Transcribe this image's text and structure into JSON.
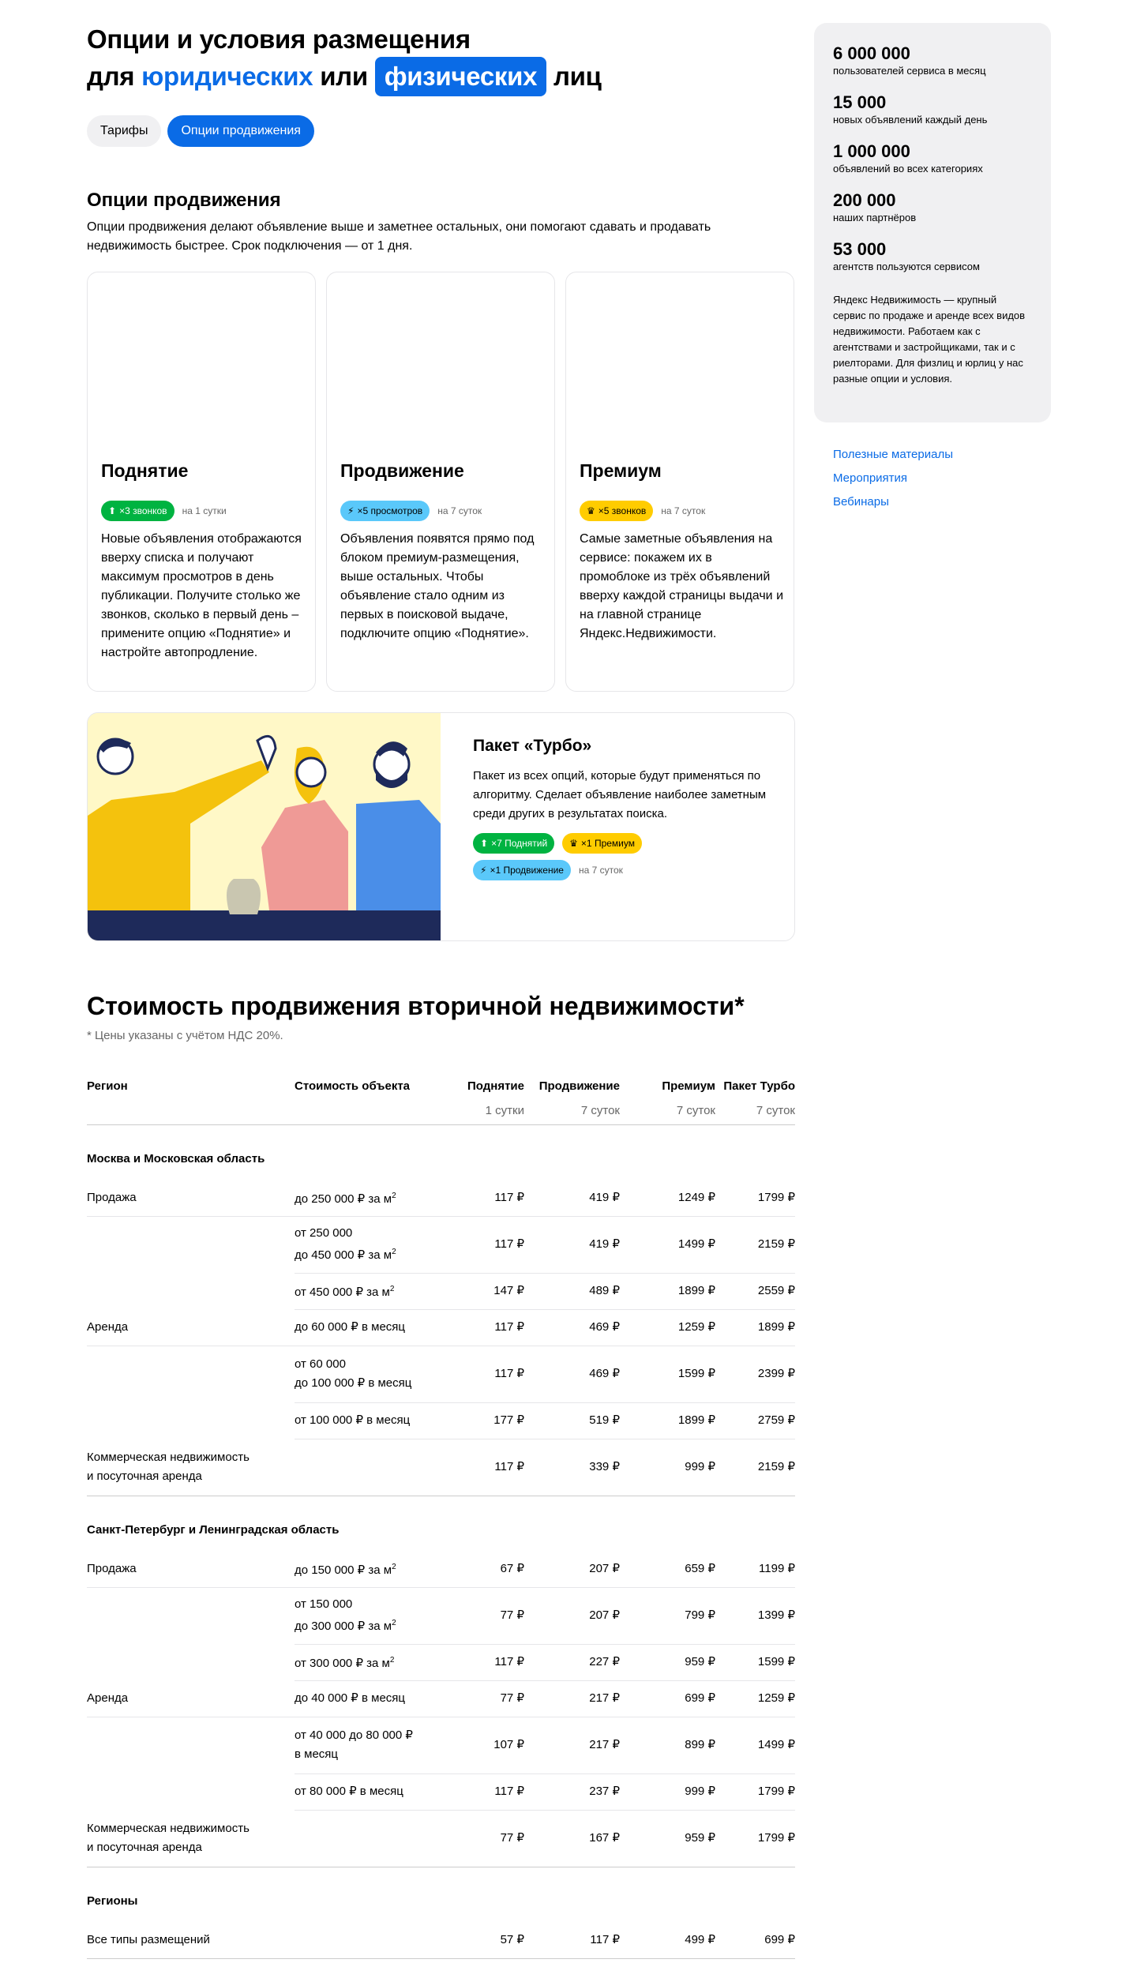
{
  "header": {
    "title_line1": "Опции и условия размещения",
    "title_for": "для",
    "title_legal": "юридических",
    "title_or": "или",
    "title_physical": "физических",
    "title_persons": "лиц"
  },
  "tabs": [
    {
      "label": "Тарифы",
      "active": false
    },
    {
      "label": "Опции продвижения",
      "active": true
    }
  ],
  "promo": {
    "heading": "Опции продвижения",
    "intro": "Опции продвижения делают объявление выше и заметнее остальных, они помогают сдавать и продавать недвижимость быстрее. Срок подключения — от 1 дня.",
    "cards": [
      {
        "title": "Поднятие",
        "badge": "×3 звонков",
        "period": "на 1 сутки",
        "desc": "Новые объявления отображаются вверху списка и получают максимум просмотров в день публикации. Получите столько же звонков, сколько в первый день – примените опцию «Поднятие» и настройте автопродление."
      },
      {
        "title": "Продвижение",
        "badge": "×5 просмотров",
        "period": "на 7 суток",
        "desc": "Объявления появятся прямо под блоком премиум-размещения, выше остальных. Чтобы объявление стало одним из первых в поисковой выдаче, подключите опцию «Поднятие»."
      },
      {
        "title": "Премиум",
        "badge": "×5 звонков",
        "period": "на 7 суток",
        "desc": "Самые заметные объявления на сервисе: покажем их в промоблоке из трёх объявлений вверху каждой страницы выдачи и на главной странице Яндекс.Недвижимости."
      }
    ],
    "turbo": {
      "title": "Пакет «Турбо»",
      "desc": "Пакет из всех опций, которые будут применяться по алгоритму. Сделает объявление наиболее заметным среди других в результатах поиска.",
      "badge_up": "×7 Поднятий",
      "badge_premium": "×1 Премиум",
      "badge_promo": "×1 Продвижение",
      "period": "на 7 суток"
    }
  },
  "pricing": {
    "heading": "Стоимость продвижения вторичной недвижимости*",
    "note": "* Цены указаны с учётом НДС 20%.",
    "columns": [
      "Регион",
      "Стоимость объекта",
      "Поднятие",
      "Продвижение",
      "Премиум",
      "Пакет Турбо"
    ],
    "periods": [
      "1 сутки",
      "7 суток",
      "7 суток",
      "7 суток"
    ],
    "groups": [
      {
        "name": "Москва и Московская область",
        "rows": [
          {
            "type": "Продажа",
            "object": "до 250 000 ₽ за м",
            "sup": "2",
            "v": [
              "117 ₽",
              "419 ₽",
              "1249 ₽",
              "1799 ₽"
            ]
          },
          {
            "type": "",
            "object": "от 250 000",
            "object2": "до 450 000 ₽ за м",
            "sup": "2",
            "v": [
              "117 ₽",
              "419 ₽",
              "1499 ₽",
              "2159 ₽"
            ]
          },
          {
            "type": "",
            "object": "от 450 000 ₽ за м",
            "sup": "2",
            "v": [
              "147 ₽",
              "489 ₽",
              "1899 ₽",
              "2559 ₽"
            ]
          },
          {
            "type": "Аренда",
            "object": "до 60 000 ₽ в месяц",
            "v": [
              "117 ₽",
              "469 ₽",
              "1259 ₽",
              "1899 ₽"
            ]
          },
          {
            "type": "",
            "object": "от 60 000",
            "object2": "до 100 000 ₽ в месяц",
            "v": [
              "117 ₽",
              "469 ₽",
              "1599 ₽",
              "2399 ₽"
            ]
          },
          {
            "type": "",
            "object": "от 100 000 ₽ в месяц",
            "v": [
              "177 ₽",
              "519 ₽",
              "1899 ₽",
              "2759 ₽"
            ]
          },
          {
            "type": "Коммерческая недвижимость",
            "type2": "и посуточная аренда",
            "object": "",
            "v": [
              "117 ₽",
              "339 ₽",
              "999 ₽",
              "2159 ₽"
            ]
          }
        ]
      },
      {
        "name": "Санкт-Петербург и Ленинградская область",
        "rows": [
          {
            "type": "Продажа",
            "object": "до 150 000 ₽ за м",
            "sup": "2",
            "v": [
              "67 ₽",
              "207 ₽",
              "659 ₽",
              "1199 ₽"
            ]
          },
          {
            "type": "",
            "object": "от 150 000",
            "object2": "до 300 000 ₽ за м",
            "sup": "2",
            "v": [
              "77 ₽",
              "207 ₽",
              "799 ₽",
              "1399 ₽"
            ]
          },
          {
            "type": "",
            "object": "от 300 000 ₽ за м",
            "sup": "2",
            "v": [
              "117 ₽",
              "227 ₽",
              "959 ₽",
              "1599 ₽"
            ]
          },
          {
            "type": "Аренда",
            "object": "до 40 000 ₽ в месяц",
            "v": [
              "77 ₽",
              "217 ₽",
              "699 ₽",
              "1259 ₽"
            ]
          },
          {
            "type": "",
            "object": "от 40 000 до 80 000 ₽",
            "object2": "в месяц",
            "v": [
              "107 ₽",
              "217 ₽",
              "899 ₽",
              "1499 ₽"
            ]
          },
          {
            "type": "",
            "object": "от 80 000 ₽ в месяц",
            "v": [
              "117 ₽",
              "237 ₽",
              "999 ₽",
              "1799 ₽"
            ]
          },
          {
            "type": "Коммерческая недвижимость",
            "type2": "и посуточная аренда",
            "object": "",
            "v": [
              "77 ₽",
              "167 ₽",
              "959 ₽",
              "1799 ₽"
            ]
          }
        ]
      },
      {
        "name": "Регионы",
        "rows": [
          {
            "type": "Все типы размещений",
            "object": "",
            "v": [
              "57 ₽",
              "117 ₽",
              "499 ₽",
              "699 ₽"
            ]
          }
        ]
      }
    ]
  },
  "sidebar": {
    "stats": [
      {
        "num": "6 000 000",
        "label": "пользователей сервиса в месяц"
      },
      {
        "num": "15 000",
        "label": "новых объявлений каждый день"
      },
      {
        "num": "1 000 000",
        "label": "объявлений во всех категориях"
      },
      {
        "num": "200 000",
        "label": "наших партнёров"
      },
      {
        "num": "53 000",
        "label": "агентств пользуются сервисом"
      }
    ],
    "about": "Яндекс Недвижимость — крупный сервис по продаже и аренде всех видов недвижимости. Работаем как с агентствами и застройщиками, так и с риелторами. Для физлиц и юрлиц у нас разные опции и условия.",
    "links": [
      "Полезные материалы",
      "Мероприятия",
      "Вебинары"
    ]
  }
}
